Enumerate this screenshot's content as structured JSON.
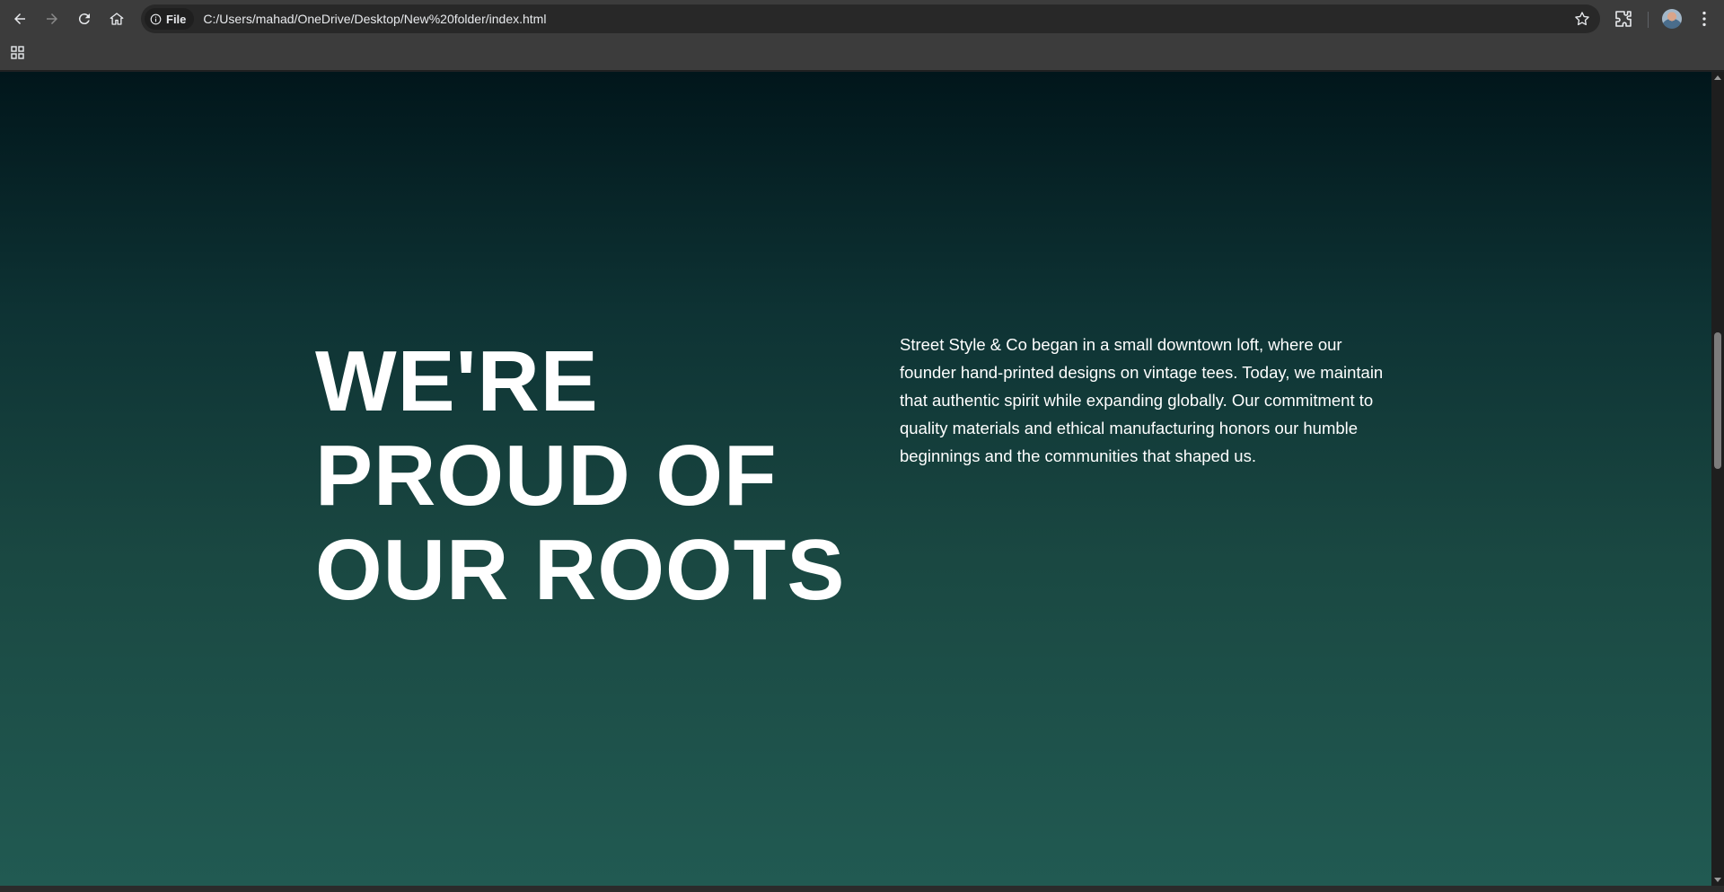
{
  "browser": {
    "site_chip_label": "File",
    "url": "C:/Users/mahad/OneDrive/Desktop/New%20folder/index.html",
    "icons": {
      "back": "back-arrow-icon",
      "forward": "forward-arrow-icon",
      "reload": "reload-icon",
      "home": "home-icon",
      "info": "info-icon",
      "bookmark": "star-icon",
      "extensions": "puzzle-icon",
      "profile": "avatar",
      "menu": "kebab-menu-icon",
      "apps": "apps-grid-icon"
    }
  },
  "hero": {
    "title_lines": [
      "WE'RE",
      "PROUD OF",
      "OUR ROOTS"
    ],
    "paragraph": "Street Style & Co began in a small downtown loft, where our founder hand-printed designs on vintage tees. Today, we maintain that authentic spirit while expanding globally. Our commitment to quality materials and ethical manufacturing honors our humble beginnings and the communities that shaped us."
  },
  "colors": {
    "background_top": "#01161b",
    "background_bottom": "#215a52",
    "text": "#ffffff",
    "chrome": "#3c3c3c"
  }
}
